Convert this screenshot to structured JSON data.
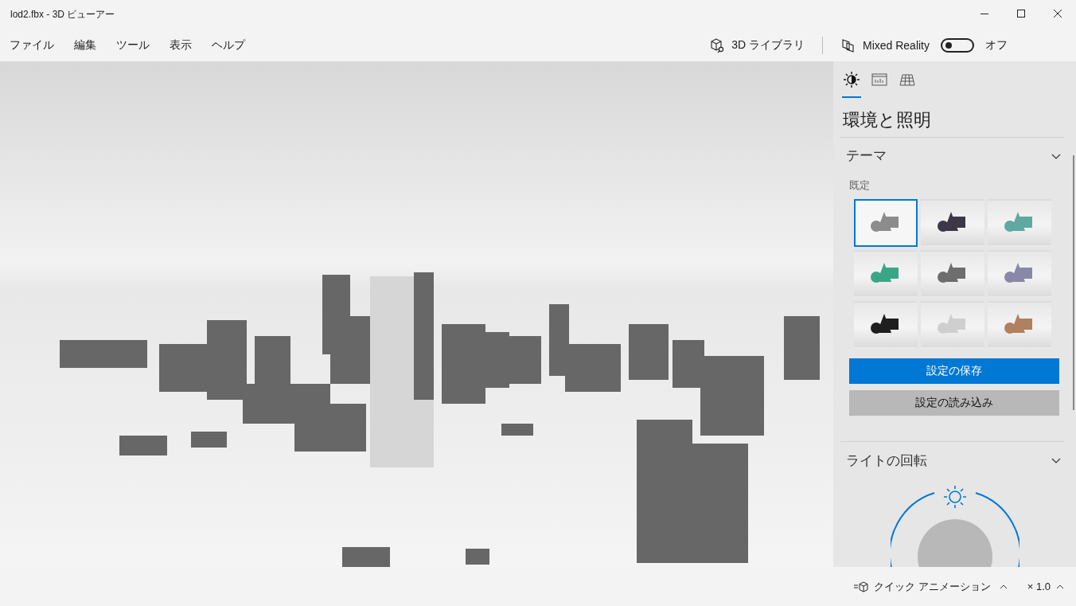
{
  "window": {
    "title": "lod2.fbx - 3D ビューアー"
  },
  "menu": [
    "ファイル",
    "編集",
    "ツール",
    "表示",
    "ヘルプ"
  ],
  "toolbar": {
    "library_button": "3D ライブラリ",
    "mixed_reality": {
      "label": "Mixed Reality",
      "on": false,
      "state_label": "オフ"
    }
  },
  "panel": {
    "tabs": [
      {
        "kind": "lighting",
        "selected": true
      },
      {
        "kind": "stats",
        "selected": false
      },
      {
        "kind": "grid",
        "selected": false
      }
    ],
    "heading": "環境と照明",
    "theme": {
      "title": "テーマ",
      "subtitle": "既定",
      "tiles": [
        {
          "color": "#8c8c8c",
          "selected": true
        },
        {
          "color": "#3c3848",
          "selected": false
        },
        {
          "color": "#5fa9a0",
          "selected": false
        },
        {
          "color": "#3aa688",
          "selected": false
        },
        {
          "color": "#6e6e6e",
          "selected": false
        },
        {
          "color": "#8a88a8",
          "selected": false
        },
        {
          "color": "#1e1e1e",
          "selected": false
        },
        {
          "color": "#cfcfcf",
          "selected": false
        },
        {
          "color": "#b08060",
          "selected": false
        }
      ],
      "save_button": "設定の保存",
      "load_button": "設定の読み込み"
    },
    "light_rotation": {
      "title": "ライトの回転"
    }
  },
  "footer": {
    "animation_button": "クイック アニメーション",
    "speed": "× 1.0"
  }
}
